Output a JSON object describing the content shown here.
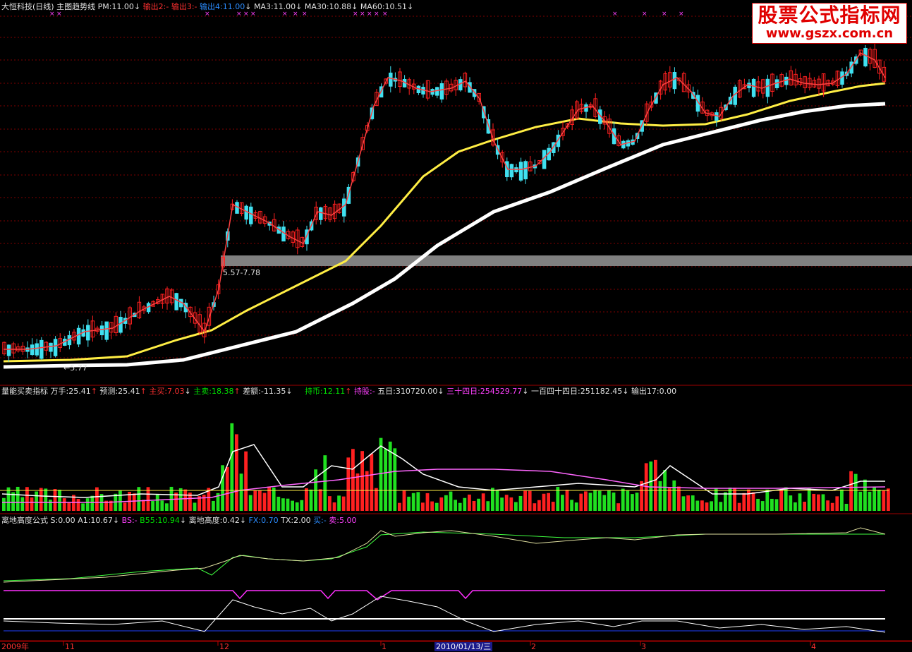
{
  "colors": {
    "bg": "#000000",
    "up": "#ff2020",
    "down": "#40e0f0",
    "ma30": "#ffee44",
    "ma60": "#ffffff",
    "grid": "#800000",
    "vol_up": "#ff2020",
    "vol_down": "#20e020"
  },
  "main": {
    "title": "大恒科技(日线)",
    "indicator_name": "主图趋势线",
    "pm": "PM:11.00",
    "out2": "输出2:-",
    "out3": "输出3:-",
    "out4": "输出4:11.00",
    "ma3": "MA3:11.00",
    "ma30": "MA30:10.88",
    "ma60": "MA60:10.51",
    "range_label": "5.57-7.78",
    "low_label": "←5.77",
    "arrow_down": "↓"
  },
  "volume": {
    "name": "量能买卖指标",
    "wanshou": "万手:25.41",
    "yuce": "预测:25.41",
    "zhumai": "主买:7.03",
    "zhumai2": "主卖:18.38",
    "chae": "差额:-11.35",
    "chibi": "持币:12.11",
    "chigu": "持股:-",
    "wuri": "五日:310720.00",
    "sanshisi": "三十四日:254529.77",
    "yibaisisi": "一百四十四日:251182.45",
    "shuchu": "输出17:0.00",
    "arrow_up": "↑",
    "arrow_down": "↓"
  },
  "sub": {
    "name": "离地高度公式",
    "s": "S:0.00",
    "a1": "A1:10.67",
    "bs": "BS:-",
    "b55": "B55:10.94",
    "height": "离地高度:0.42",
    "fx": "FX:0.70",
    "tx": "TX:2.00",
    "buy": "买:-",
    "sell": "卖:5.00",
    "arrow_up": "↑",
    "arrow_down": "↓"
  },
  "axis": {
    "labels": [
      "2009年",
      "11",
      "12",
      "1",
      "2010/01/13/三",
      "2",
      "3",
      "4"
    ]
  },
  "watermark": {
    "line1": "股票公式指标网",
    "line2": "www.gszx.com.cn"
  }
}
